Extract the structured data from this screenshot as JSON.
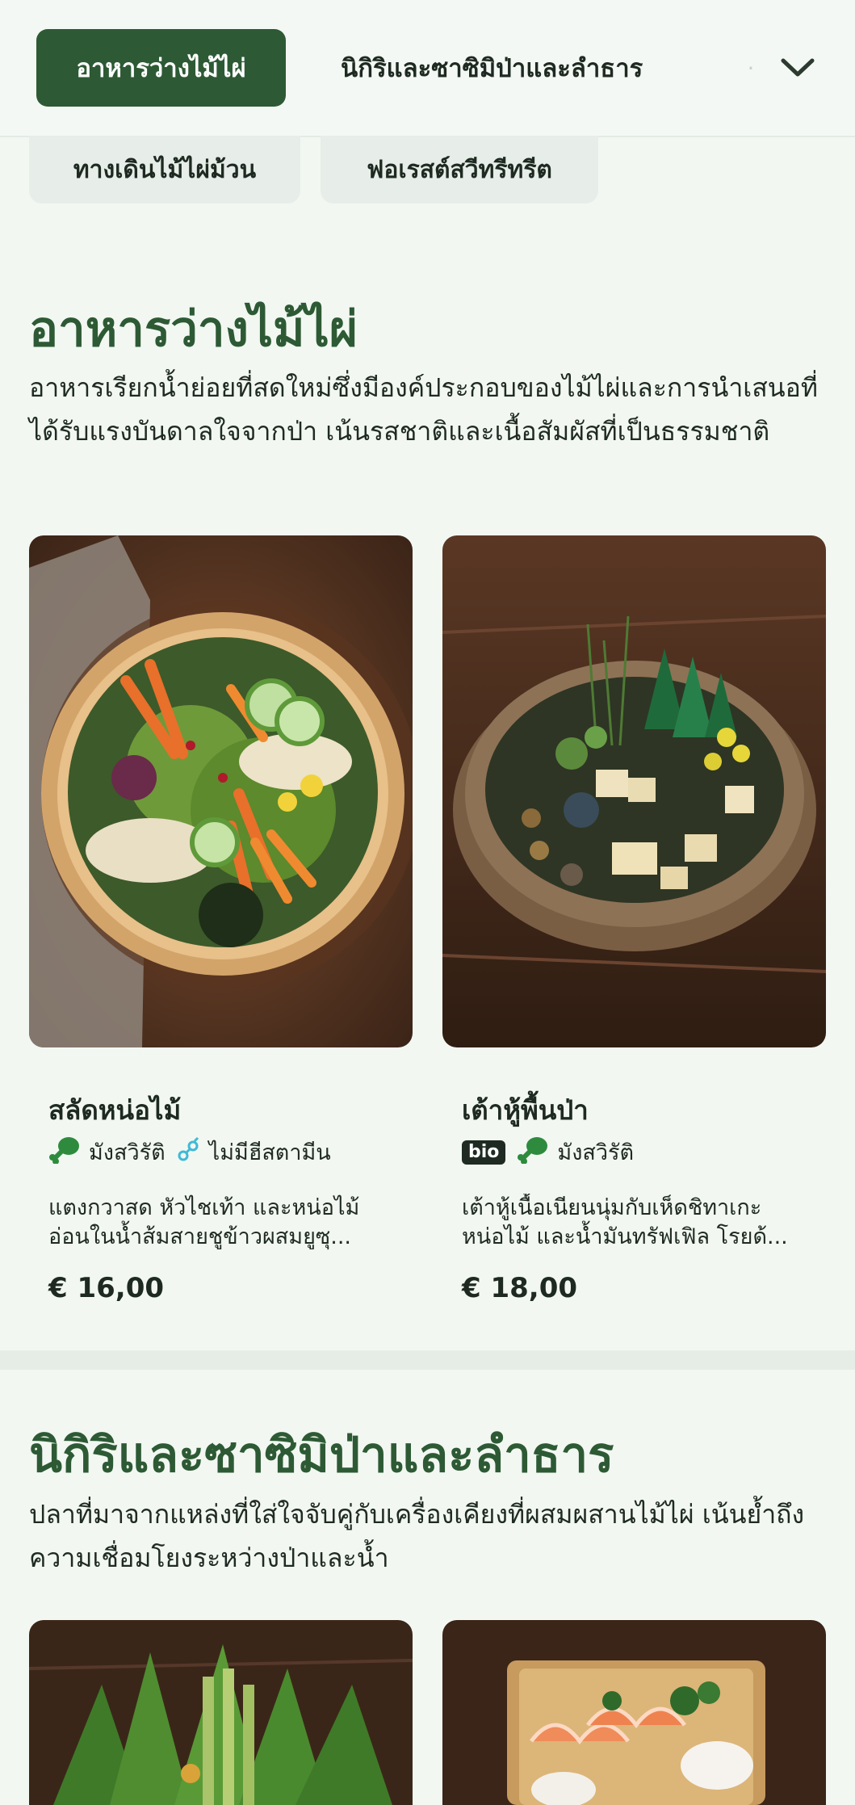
{
  "topnav": {
    "categories": [
      {
        "label": "อาหารว่างไม้ไผ่",
        "active": true
      },
      {
        "label": "นิกิริและซาซิมิป่าและลำธาร",
        "active": false
      }
    ],
    "more_icon": "chevron-down-icon"
  },
  "subtabs": [
    "ทางเดินไม้ไผ่ม้วน",
    "ฟอเรสต์สวีทรีทรีต"
  ],
  "sections": [
    {
      "title": "อาหารว่างไม้ไผ่",
      "description": "อาหารเรียกน้ำย่อยที่สดใหม่ซึ่งมีองค์ประกอบของไม้ไผ่และการนำเสนอที่ได้รับแรงบันดาลใจจากป่า เน้นรสชาติและเนื้อสัมผัสที่เป็นธรรมชาติ",
      "items": [
        {
          "name": "สลัดหน่อไม้",
          "tags": [
            {
              "icon": "vegetarian-leg-icon",
              "label": "มังสวิรัติ"
            },
            {
              "icon": "histamine-free-icon",
              "label": "ไม่มีฮีสตามีน"
            }
          ],
          "description": "แตงกวาสด หัวไชเท้า และหน่อไม้อ่อนในน้ำส้มสายชูข้าวผสมยูซุ...",
          "price": "€ 16,00"
        },
        {
          "name": "เต้าหู้พื้นป่า",
          "bio_label": "bio",
          "tags": [
            {
              "icon": "vegetarian-leg-icon",
              "label": "มังสวิรัติ"
            }
          ],
          "description": "เต้าหู้เนื้อเนียนนุ่มกับเห็ดชิทาเกะ หน่อไม้ และน้ำมันทรัฟเฟิล โรยด้...",
          "price": "€ 18,00"
        }
      ]
    },
    {
      "title": "นิกิริและซาซิมิป่าและลำธาร",
      "description": "ปลาที่มาจากแหล่งที่ใส่ใจจับคู่กับเครื่องเคียงที่ผสมผสานไม้ไผ่ เน้นย้ำถึงความเชื่อมโยงระหว่างป่าและน้ำ"
    }
  ],
  "colors": {
    "accent": "#2d5a34",
    "background": "#f2f7f2",
    "tag_icon_green": "#2e8b3e",
    "tag_icon_cyan": "#3fb9d6"
  }
}
